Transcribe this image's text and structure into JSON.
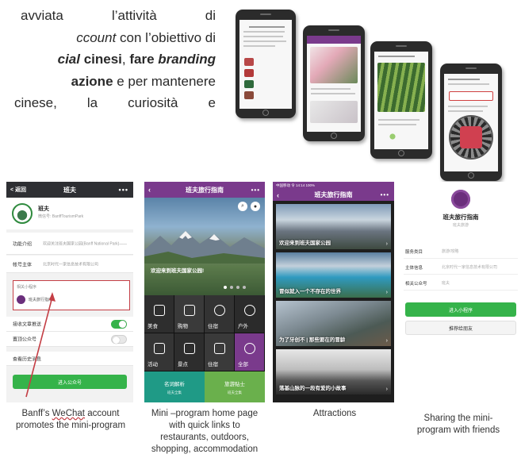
{
  "paragraph": {
    "l1_a": "avviata l’attività di",
    "l2_italic": "ccount",
    "l2_rest": " con l’obiettivo di",
    "l3_boldital": "cial",
    "l3_bold1": " cinesi",
    "l3_sep": ", ",
    "l3_bold2": "fare ",
    "l3_boldital2": "branding",
    "l4_bold": "azione",
    "l4_rest": " e per mantenere",
    "l5": "cinese, la curiosità e"
  },
  "screen1": {
    "back": "< 返回",
    "title": "班夫",
    "more": "•••",
    "name": "班夫",
    "handle": "微信号: BanffTourismPark",
    "rows": [
      {
        "k": "功能介绍",
        "v": "欢迎关注班夫国家公园(Banff National Park)——加拿大的“白雪皇”"
      },
      {
        "k": "帐号主体",
        "v": "北京时代一家信息技术有限公司"
      }
    ],
    "mini_label": "相关小程序",
    "mini_name": "班夫旅行指南",
    "toggles": [
      {
        "k": "接收文章推送",
        "on": true
      },
      {
        "k": "置顶公众号",
        "on": false
      }
    ],
    "history": "查看历史消息",
    "enter": "进入公众号"
  },
  "screen2": {
    "title": "班夫旅行指南",
    "hero_caption": "欢迎来到班夫国家公园!",
    "grid": [
      "美食",
      "购物",
      "住宿",
      "户外",
      "活动",
      "景点",
      "住宿",
      "全部"
    ],
    "tabs": [
      {
        "label": "名词解析",
        "sub": "班夫全集"
      },
      {
        "label": "旅游贴士",
        "sub": "班夫全集"
      }
    ]
  },
  "screen3": {
    "status": "中国移动 令 14:14 100%",
    "title": "班夫旅行指南",
    "cards": [
      "欢迎来到班夫国家公园",
      "冒似就入一个不存在的世界",
      "为了牙创不 | 那些要在的冒龄",
      "落基山脉的一段有爱的小故事"
    ]
  },
  "screen4": {
    "title": "班夫旅行指南",
    "sub": "班夫旅游",
    "rows": [
      {
        "k": "服务类目",
        "v": "旅游/攻略"
      },
      {
        "k": "主体信息",
        "v": "北京时代一家信息技术有限公司"
      },
      {
        "k": "相关公众号",
        "v": "班夫"
      }
    ],
    "enter": "进入小程序",
    "share": "推荐给朋友"
  },
  "captions": {
    "c1_a": "Banff’s ",
    "c1_u": "WeChat",
    "c1_b": " account",
    "c1_l2": "promotes the mini-program",
    "c2_l1": "Mini –program home page",
    "c2_l2": "with quick links to",
    "c2_l3": "restaurants, outdoors,",
    "c2_l4": "shopping, accommodation",
    "c3": "Attractions",
    "c4_l1": "Sharing the mini-",
    "c4_l2": "program with friends"
  },
  "colors": {
    "wechat_green": "#35b34a",
    "miniprogram_purple": "#7a3a8c",
    "teal": "#1f9a86",
    "highlight_red": "#c43e45"
  }
}
